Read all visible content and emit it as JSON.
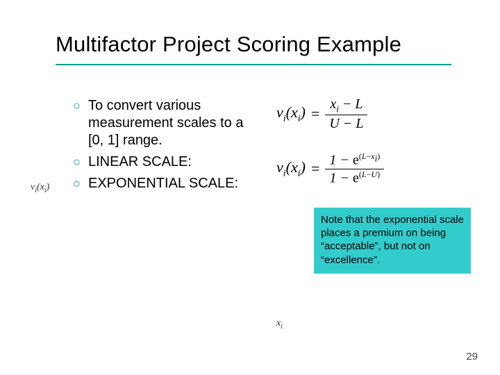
{
  "title": "Multifactor Project Scoring Example",
  "bullets": [
    "To convert various measurement scales to a [0, 1] range.",
    "LINEAR SCALE:",
    "EXPONENTIAL SCALE:"
  ],
  "side_math_html": "v<sub>i</sub>(x<sub>i</sub>)",
  "bottom_math_html": "x<sub>i</sub>",
  "eq1": {
    "lhs_html": "v<sub>i</sub>(x<sub>i</sub>)",
    "num_html": "x<sub>i</sub> &minus; L",
    "den_html": "U &minus; L"
  },
  "eq2": {
    "lhs_html": "v<sub>i</sub>(x<sub>i</sub>)",
    "num_html": "1 &minus; <span class=\"exp\">e</span><sup>(<span class=\"ivar\">L</span>&minus;<span class=\"ivar\">x<sub>i</sub></span>)</sup>",
    "den_html": "1 &minus; <span class=\"exp\">e</span><sup>(<span class=\"ivar\">L</span>&minus;<span class=\"ivar\">U</span>)</sup>"
  },
  "note": "Note that the exponential scale places a premium on being “acceptable”, but not on “excellence”.",
  "page": "29",
  "colors": {
    "accent": "#009a8e",
    "note_bg": "#33cccc"
  }
}
